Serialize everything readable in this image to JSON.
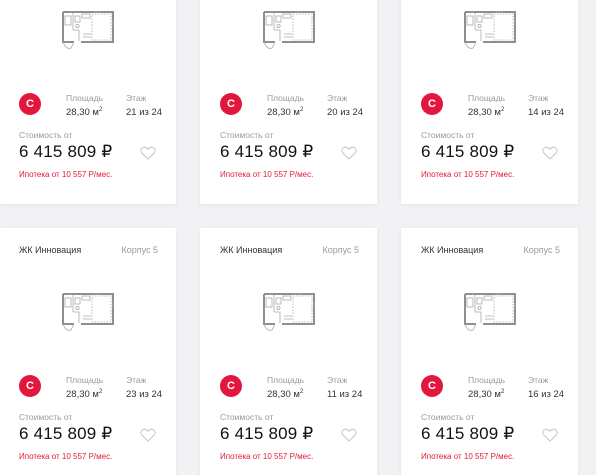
{
  "labels": {
    "area": "Площадь",
    "floor": "Этаж",
    "cost": "Стоимость от",
    "badge": "С"
  },
  "cards": [
    {
      "complex": "",
      "korpus": "",
      "area": "28,30 м",
      "area_unit": "2",
      "floor": "21 из 24",
      "price": "6 415 809 ₽",
      "mortgage": "Ипотека от 10 557 Р/мес."
    },
    {
      "complex": "",
      "korpus": "",
      "area": "28,30 м",
      "area_unit": "2",
      "floor": "20 из 24",
      "price": "6 415 809 ₽",
      "mortgage": "Ипотека от 10 557 Р/мес."
    },
    {
      "complex": "",
      "korpus": "",
      "area": "28,30 м",
      "area_unit": "2",
      "floor": "14 из 24",
      "price": "6 415 809 ₽",
      "mortgage": "Ипотека от 10 557 Р/мес."
    },
    {
      "complex": "ЖК Инновация",
      "korpus": "Корпус 5",
      "area": "28,30 м",
      "area_unit": "2",
      "floor": "23 из 24",
      "price": "6 415 809 ₽",
      "mortgage": "Ипотека от 10 557 Р/мес."
    },
    {
      "complex": "ЖК Инновация",
      "korpus": "Корпус 5",
      "area": "28,30 м",
      "area_unit": "2",
      "floor": "11 из 24",
      "price": "6 415 809 ₽",
      "mortgage": "Ипотека от 10 557 Р/мес."
    },
    {
      "complex": "ЖК Инновация",
      "korpus": "Корпус 5",
      "area": "28,30 м",
      "area_unit": "2",
      "floor": "16 из 24",
      "price": "6 415 809 ₽",
      "mortgage": "Ипотека от 10 557 Р/мес."
    }
  ],
  "icons": {
    "plan": "floor-plan-icon",
    "favorite": "heart-icon"
  },
  "colors": {
    "accent": "#e3173e",
    "background": "#f2f2f4",
    "card": "#ffffff"
  }
}
